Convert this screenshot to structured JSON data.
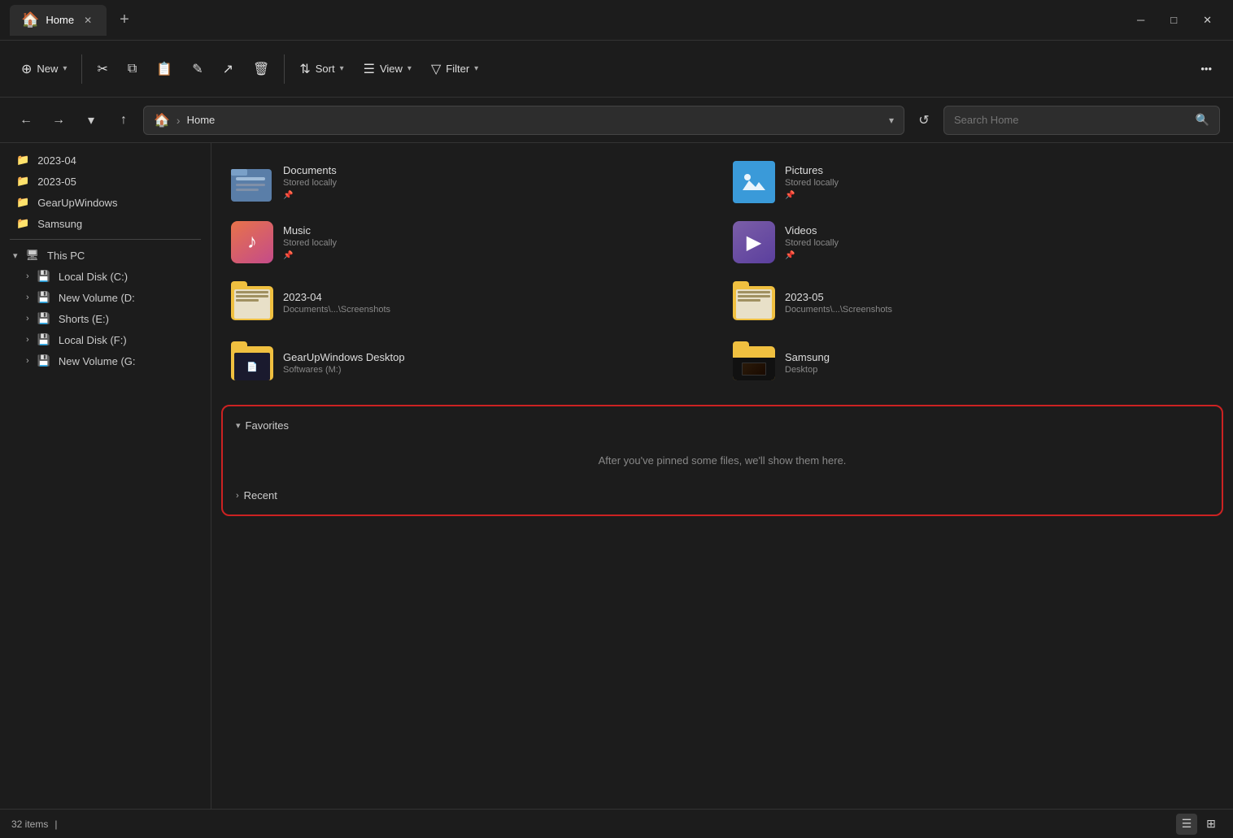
{
  "window": {
    "title": "Home",
    "tab_close": "✕",
    "tab_new": "+",
    "controls": {
      "minimize": "─",
      "maximize": "□",
      "close": "✕"
    }
  },
  "toolbar": {
    "new_label": "New",
    "new_chevron": "▾",
    "cut_icon": "✂",
    "copy_icon": "⧉",
    "paste_icon": "📋",
    "rename_icon": "✎",
    "share_icon": "↗",
    "delete_icon": "🗑",
    "sort_label": "Sort",
    "sort_chevron": "▾",
    "view_label": "View",
    "view_chevron": "▾",
    "filter_label": "Filter",
    "filter_chevron": "▾",
    "more_icon": "•••"
  },
  "navbar": {
    "back": "←",
    "forward": "→",
    "recent_chevron": "▾",
    "up": "↑",
    "address": "Home",
    "address_chevron": "▾",
    "refresh": "↺",
    "search_placeholder": "Search Home"
  },
  "sidebar": {
    "folders": [
      {
        "name": "2023-04",
        "icon": "📁"
      },
      {
        "name": "2023-05",
        "icon": "📁"
      },
      {
        "name": "GearUpWindows",
        "icon": "📁"
      },
      {
        "name": "Samsung",
        "icon": "📁"
      }
    ],
    "this_pc": {
      "label": "This PC",
      "expand": "▾",
      "drives": [
        {
          "name": "Local Disk (C:)",
          "expand": "›"
        },
        {
          "name": "New Volume (D:",
          "expand": "›"
        },
        {
          "name": "Shorts (E:)",
          "expand": "›"
        },
        {
          "name": "Local Disk (F:)",
          "expand": "›"
        },
        {
          "name": "New Volume (G:",
          "expand": "›"
        }
      ]
    }
  },
  "content": {
    "folders": [
      {
        "id": "documents",
        "name": "Documents",
        "sub": "Stored locally",
        "pinned": true,
        "type": "documents"
      },
      {
        "id": "pictures",
        "name": "Pictures",
        "sub": "Stored locally",
        "pinned": true,
        "type": "pictures"
      },
      {
        "id": "music",
        "name": "Music",
        "sub": "Stored locally",
        "pinned": true,
        "type": "music"
      },
      {
        "id": "videos",
        "name": "Videos",
        "sub": "Stored locally",
        "pinned": true,
        "type": "videos"
      },
      {
        "id": "2023-04",
        "name": "2023-04",
        "sub": "Documents\\...\\Screenshots",
        "pinned": false,
        "type": "folder"
      },
      {
        "id": "2023-05",
        "name": "2023-05",
        "sub": "Documents\\...\\Screenshots",
        "pinned": false,
        "type": "folder"
      },
      {
        "id": "gearup",
        "name": "GearUpWindows Desktop",
        "sub": "Softwares (M:)",
        "pinned": false,
        "type": "folder"
      },
      {
        "id": "samsung",
        "name": "Samsung",
        "sub": "Desktop",
        "pinned": false,
        "type": "samsung"
      }
    ],
    "favorites": {
      "label": "Favorites",
      "expanded": true,
      "chevron": "▾",
      "empty_text": "After you've pinned some files, we'll show them here."
    },
    "recent": {
      "label": "Recent",
      "collapsed": true,
      "chevron": "›"
    }
  },
  "statusbar": {
    "items_count": "32 items",
    "separator": "|",
    "view_list": "☰",
    "view_tiles": "⊞"
  }
}
